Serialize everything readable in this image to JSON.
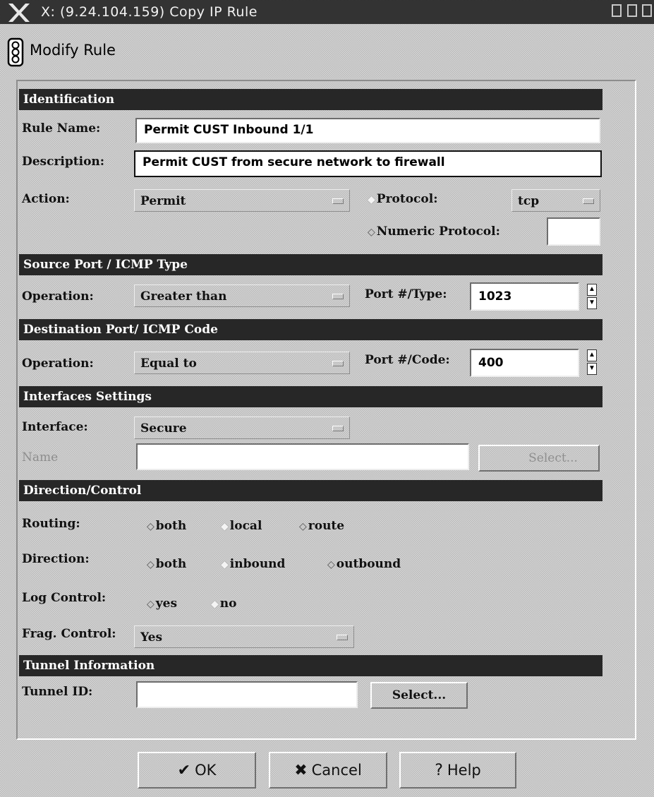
{
  "window": {
    "title": "X: (9.24.104.159) Copy IP Rule"
  },
  "heading": "Modify Rule",
  "identification": {
    "header": "Identification",
    "rule_name_label": "Rule Name:",
    "rule_name": "Permit CUST Inbound 1/1",
    "description_label": "Description:",
    "description": "Permit CUST from secure network to firewall",
    "action_label": "Action:",
    "action": "Permit",
    "protocol_label": "Protocol:",
    "protocol": "tcp",
    "numeric_protocol_label": "Numeric Protocol:",
    "numeric_protocol": "",
    "protocol_mode_selected": "Protocol"
  },
  "source_port": {
    "header": "Source Port / ICMP Type",
    "operation_label": "Operation:",
    "operation": "Greater than",
    "port_label": "Port #/Type:",
    "port": "1023"
  },
  "dest_port": {
    "header": "Destination Port/ ICMP Code",
    "operation_label": "Operation:",
    "operation": "Equal to",
    "port_label": "Port #/Code:",
    "port": "400"
  },
  "interfaces": {
    "header": "Interfaces Settings",
    "interface_label": "Interface:",
    "interface": "Secure",
    "name_label": "Name",
    "name_value": "",
    "select_label": "Select..."
  },
  "direction_control": {
    "header": "Direction/Control",
    "routing_label": "Routing:",
    "routing_options": [
      "both",
      "local",
      "route"
    ],
    "routing_selected": "local",
    "direction_label": "Direction:",
    "direction_options": [
      "both",
      "inbound",
      "outbound"
    ],
    "direction_selected": "inbound",
    "log_label": "Log Control:",
    "log_options": [
      "yes",
      "no"
    ],
    "log_selected": "no",
    "frag_label": "Frag. Control:",
    "frag": "Yes"
  },
  "tunnel": {
    "header": "Tunnel Information",
    "tunnel_id_label": "Tunnel ID:",
    "tunnel_id": "",
    "select_label": "Select..."
  },
  "buttons": {
    "ok": "OK",
    "cancel": "Cancel",
    "help": "Help"
  },
  "colors": {
    "header_bg": "#1b1b1b",
    "dialog_bg": "#d6d6d6",
    "field_bg": "#ffffff"
  }
}
